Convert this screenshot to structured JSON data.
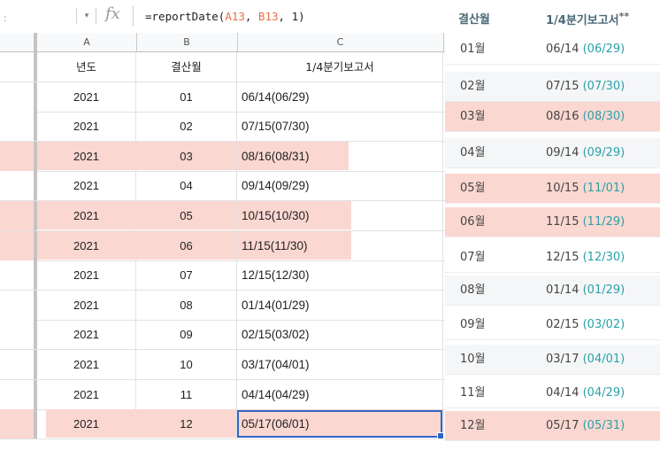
{
  "formula_bar": {
    "cell_separator": ":",
    "dropdown_icon": "chevron-down-icon",
    "fx_label": "fx",
    "formula_prefix": "=reportDate(",
    "formula_ref1": "A13",
    "formula_mid": ", ",
    "formula_ref2": "B13",
    "formula_suffix": ", 1)"
  },
  "sheet": {
    "columns": [
      "A",
      "B",
      "C"
    ],
    "highlight_color": "#fbd7d1",
    "header": {
      "a": "년도",
      "b": "결산월",
      "c": "1/4분기보고서"
    },
    "rows": [
      {
        "a": "2021",
        "b": "01",
        "c": "06/14(06/29)"
      },
      {
        "a": "2021",
        "b": "02",
        "c": "07/15(07/30)"
      },
      {
        "a": "2021",
        "b": "03",
        "c": "08/16(08/31)"
      },
      {
        "a": "2021",
        "b": "04",
        "c": "09/14(09/29)"
      },
      {
        "a": "2021",
        "b": "05",
        "c": "10/15(10/30)"
      },
      {
        "a": "2021",
        "b": "06",
        "c": "11/15(11/30)"
      },
      {
        "a": "2021",
        "b": "07",
        "c": "12/15(12/30)"
      },
      {
        "a": "2021",
        "b": "08",
        "c": "01/14(01/29)"
      },
      {
        "a": "2021",
        "b": "09",
        "c": "02/15(03/02)"
      },
      {
        "a": "2021",
        "b": "10",
        "c": "03/17(04/01)"
      },
      {
        "a": "2021",
        "b": "11",
        "c": "04/14(04/29)"
      },
      {
        "a": "2021",
        "b": "12",
        "c": "05/17(06/01)"
      }
    ],
    "selected_cell": "C13"
  },
  "reference": {
    "header_month": "결산월",
    "header_report": "1/4분기보고서",
    "header_mark": "**",
    "accent_color": "#2aa1a8",
    "rows": [
      {
        "month": "01월",
        "date": "06/14",
        "paren": "(06/29)"
      },
      {
        "month": "02월",
        "date": "07/15",
        "paren": "(07/30)"
      },
      {
        "month": "03월",
        "date": "08/16",
        "paren": "(08/30)"
      },
      {
        "month": "04월",
        "date": "09/14",
        "paren": "(09/29)"
      },
      {
        "month": "05월",
        "date": "10/15",
        "paren": "(11/01)"
      },
      {
        "month": "06월",
        "date": "11/15",
        "paren": "(11/29)"
      },
      {
        "month": "07월",
        "date": "12/15",
        "paren": "(12/30)"
      },
      {
        "month": "08월",
        "date": "01/14",
        "paren": "(01/29)"
      },
      {
        "month": "09월",
        "date": "02/15",
        "paren": "(03/02)"
      },
      {
        "month": "10월",
        "date": "03/17",
        "paren": "(04/01)"
      },
      {
        "month": "11월",
        "date": "04/14",
        "paren": "(04/29)"
      },
      {
        "month": "12월",
        "date": "05/17",
        "paren": "(05/31)"
      }
    ]
  }
}
